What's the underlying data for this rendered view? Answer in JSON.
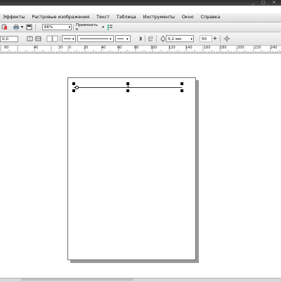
{
  "menubar": {
    "items": [
      "Эффекты",
      "Растровые изображения",
      "Текст",
      "Таблица",
      "Инструменты",
      "Окно",
      "Справка"
    ]
  },
  "titlebar": {
    "controls": [
      "_",
      "□",
      "✕"
    ]
  },
  "toolbar1": {
    "zoom_value": "66%",
    "snap_label": "Привязать к",
    "snap_arrow": "▾"
  },
  "toolbar2": {
    "position_value": "0,0",
    "outline_width": "0,2 мм",
    "value_50": "50",
    "plus": "+"
  },
  "ruler": {
    "labels": [
      "60",
      "40",
      "20",
      "0",
      "20",
      "40",
      "60",
      "80",
      "100",
      "120",
      "140",
      "160",
      "180",
      "200",
      "220",
      "240"
    ]
  }
}
